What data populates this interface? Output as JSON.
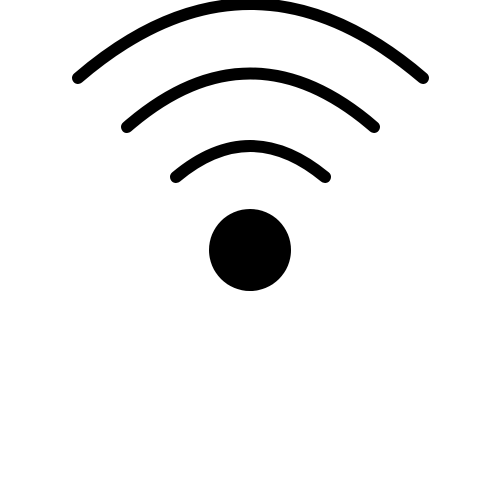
{
  "icon": {
    "name": "wifi-icon",
    "signal_bars_total": 3,
    "signal_bars_shown": 3,
    "color": "#000000",
    "background": "#ffffff"
  }
}
